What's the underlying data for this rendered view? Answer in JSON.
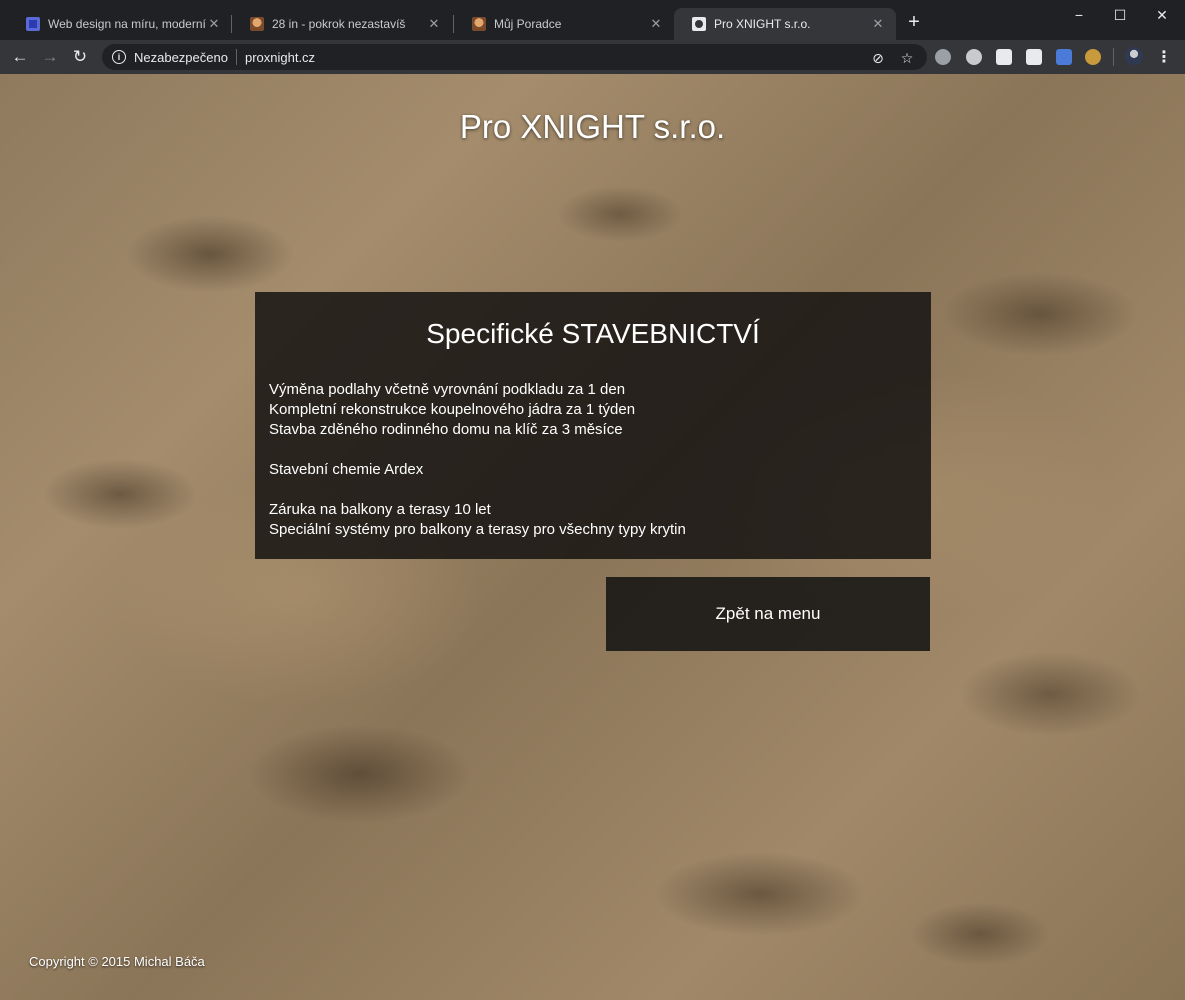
{
  "browser": {
    "tabs": [
      {
        "title": "Web design na míru, moderní, re",
        "favicon": "site-square-icon",
        "active": false
      },
      {
        "title": "28 in - pokrok nezastavíš",
        "favicon": "face-avatar-icon",
        "active": false
      },
      {
        "title": "Můj Poradce",
        "favicon": "face-avatar-icon",
        "active": false
      },
      {
        "title": "Pro XNIGHT s.r.o.",
        "favicon": "globe-icon",
        "active": true
      }
    ],
    "new_tab_label": "+",
    "window_controls": {
      "minimize": "−",
      "maximize": "☐",
      "close": "✕"
    },
    "nav": {
      "back": "←",
      "forward": "→",
      "reload": "↻"
    },
    "security_label": "Nezabezpečeno",
    "url": "proxnight.cz",
    "extension_icons": [
      "bulb-icon",
      "skype-icon",
      "checkmark-icon",
      "reader-icon",
      "translate-icon",
      "owl-icon"
    ],
    "accent_color": "#35363a"
  },
  "page": {
    "site_title": "Pro XNIGHT s.r.o.",
    "card": {
      "title": "Specifické STAVEBNICTVÍ",
      "groups": [
        {
          "lines": [
            "Výměna podlahy včetně vyrovnání podkladu za 1 den",
            "Kompletní rekonstrukce koupelnového jádra za 1 týden",
            "Stavba zděného rodinného domu na klíč za 3 měsíce"
          ]
        },
        {
          "lines": [
            "Stavební chemie Ardex"
          ]
        },
        {
          "lines": [
            "Záruka na balkony a terasy 10 let",
            "Speciální systémy pro balkony a terasy pro všechny typy krytin"
          ]
        }
      ]
    },
    "back_button": "Zpět na menu",
    "footer": "Copyright © 2015 Michal Báča"
  }
}
